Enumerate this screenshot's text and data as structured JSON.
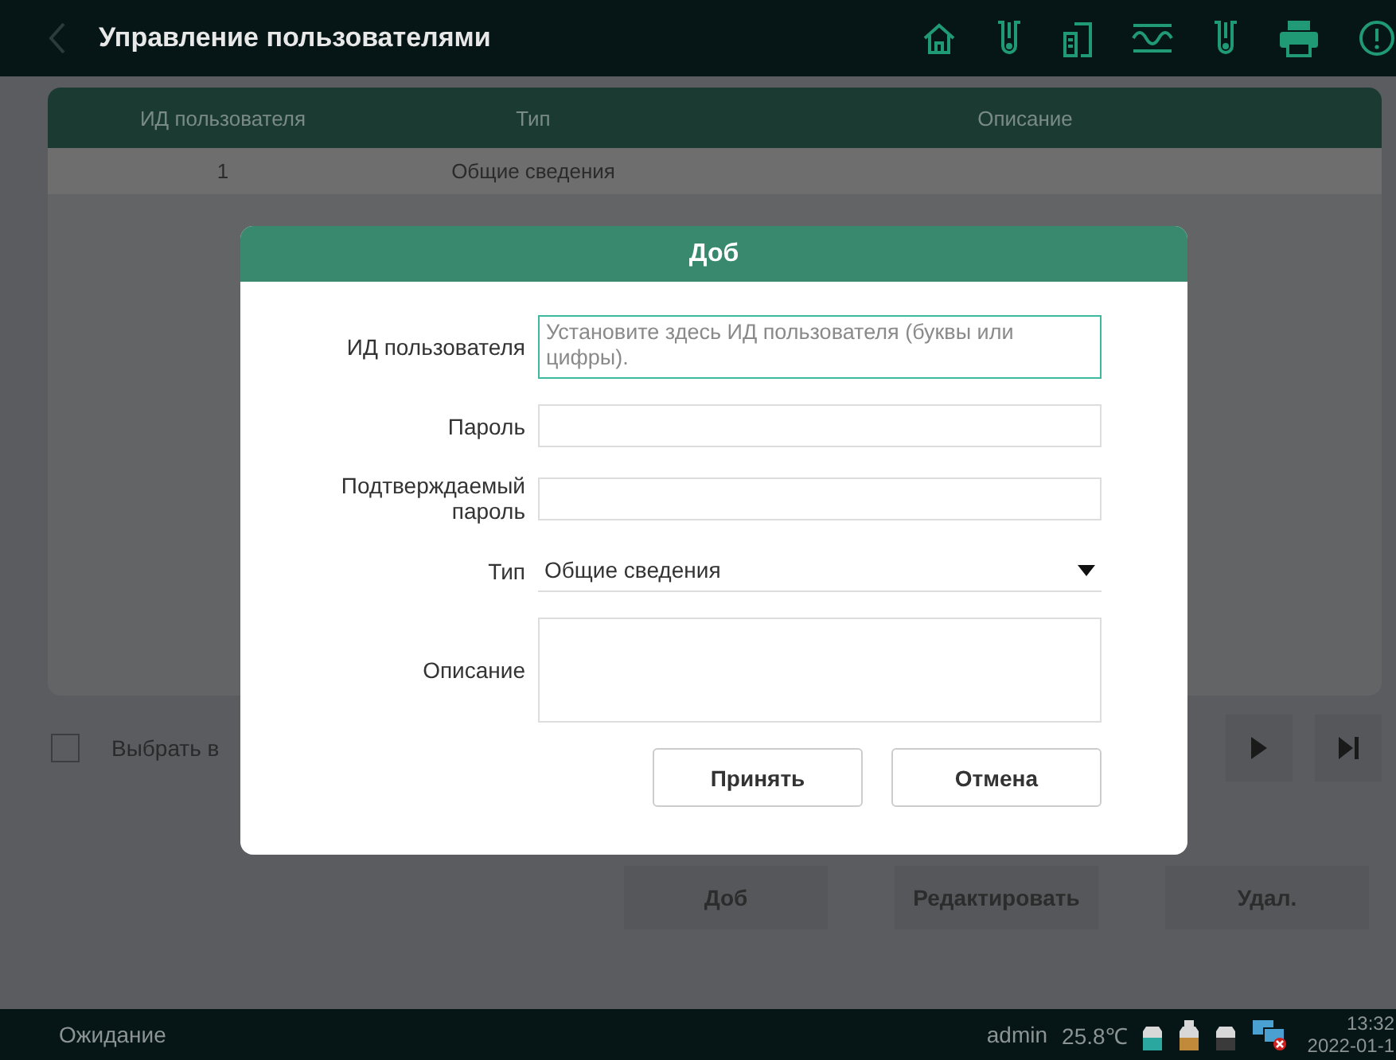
{
  "top_bar": {
    "title": "Управление пользователями"
  },
  "table": {
    "columns": [
      "ИД пользователя",
      "Тип",
      "Описание"
    ],
    "rows": [
      {
        "user_id": "1",
        "type": "Общие сведения"
      }
    ]
  },
  "select_all": {
    "label": "Выбрать в",
    "checked": false
  },
  "actions": [
    "Доб",
    "Редактировать",
    "Удал."
  ],
  "status_bar": {
    "state": "Ожидание",
    "user": "admin",
    "temperature": "25.8℃",
    "time": "13:32",
    "date": "2022-01-1"
  },
  "dialog": {
    "title": "Доб",
    "fields": [
      {
        "label": "ИД пользователя",
        "kind": "text",
        "placeholder": "Установите здесь ИД пользователя (буквы или цифры).",
        "focused": true
      },
      {
        "label": "Пароль",
        "kind": "text",
        "focused": false
      },
      {
        "label": "Подтверждаемый пароль",
        "kind": "text",
        "focused": false
      },
      {
        "label": "Тип",
        "kind": "dropdown",
        "value": "Общие сведения",
        "focused": false
      },
      {
        "label": "Описание",
        "kind": "textarea",
        "focused": false
      }
    ],
    "buttons": [
      "Принять",
      "Отмена"
    ]
  }
}
